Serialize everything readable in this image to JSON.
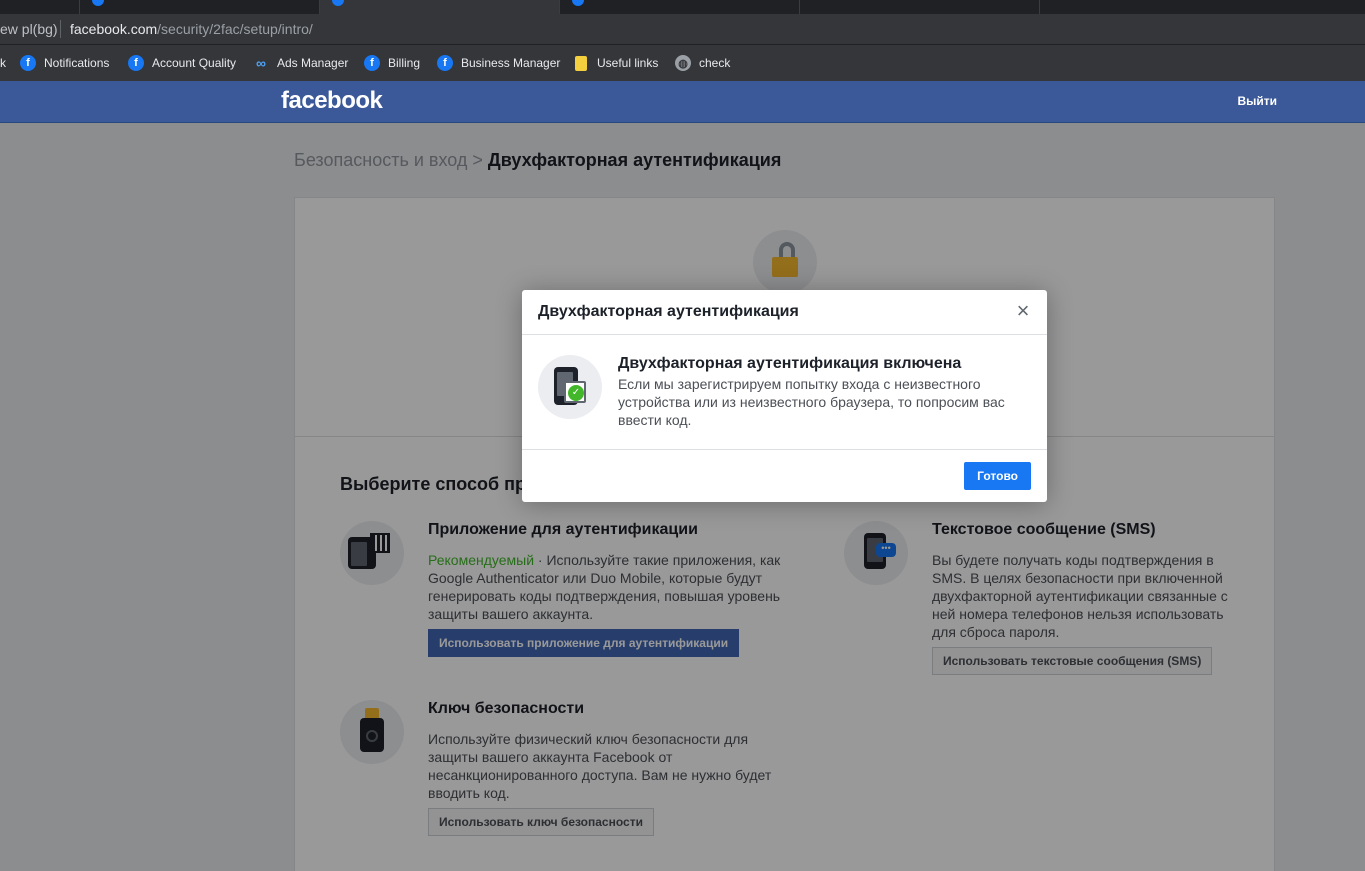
{
  "browser": {
    "left_fragment": "ew pl(bg)",
    "url_host": "facebook.com",
    "url_path": "/security/2fac/setup/intro/",
    "bookmarks": [
      {
        "label": "Notifications",
        "icon": "facebook-icon"
      },
      {
        "label": "Account Quality",
        "icon": "facebook-icon"
      },
      {
        "label": "Ads Manager",
        "icon": "meta-icon"
      },
      {
        "label": "Billing",
        "icon": "facebook-icon"
      },
      {
        "label": "Business Manager",
        "icon": "facebook-icon"
      },
      {
        "label": "Useful links",
        "icon": "folder-icon"
      },
      {
        "label": "check",
        "icon": "globe-icon"
      }
    ],
    "bookmark_fragment": "k"
  },
  "header": {
    "logo": "facebook",
    "logout": "Выйти"
  },
  "breadcrumb": {
    "parent": "Безопасность и вход",
    "separator": ">",
    "current": "Двухфакторная аутентификация"
  },
  "main": {
    "choose_title": "Выберите способ пр",
    "methods": {
      "app": {
        "title": "Приложение для аутентификации",
        "recommended": "Рекомендуемый",
        "desc": " · Используйте такие приложения, как Google Authenticator или Duo Mobile, которые будут генерировать коды подтверждения, повышая уровень защиты вашего аккаунта.",
        "button": "Использовать приложение для аутентификации"
      },
      "sms": {
        "title": "Текстовое сообщение (SMS)",
        "desc": "Вы будете получать коды подтверждения в SMS. В целях безопасности при включенной двухфакторной аутентификации связанные с ней номера телефонов нельзя использовать для сброса пароля.",
        "button": "Использовать текстовые сообщения (SMS)"
      },
      "key": {
        "title": "Ключ безопасности",
        "desc": "Используйте физический ключ безопасности для защиты вашего аккаунта Facebook от несанкционированного доступа. Вам не нужно будет вводить код.",
        "button": "Использовать ключ безопасности"
      }
    }
  },
  "modal": {
    "title": "Двухфакторная аутентификация",
    "close": "×",
    "heading": "Двухфакторная аутентификация включена",
    "text": "Если мы зарегистрируем попытку входа с неизвестного устройства или из неизвестного браузера, то попросим вас ввести код.",
    "done": "Готово"
  },
  "colors": {
    "fb_blue": "#3b5998",
    "primary": "#1877f2",
    "recommended": "#42b72a"
  }
}
